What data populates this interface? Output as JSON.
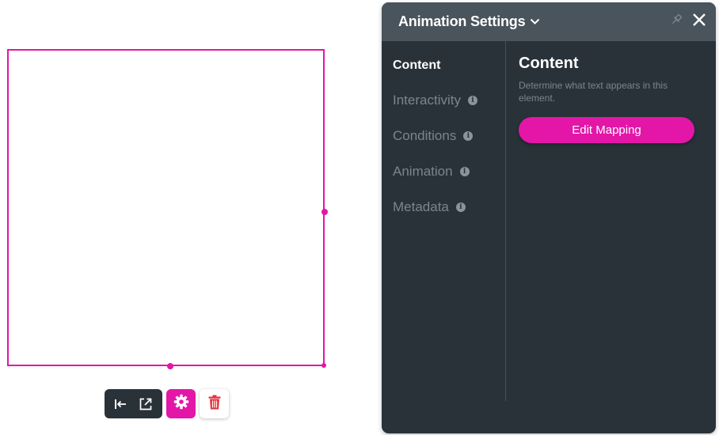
{
  "panel": {
    "title": "Animation Settings",
    "nav": [
      {
        "label": "Content",
        "active": true
      },
      {
        "label": "Interactivity",
        "info": "i"
      },
      {
        "label": "Conditions",
        "info": "i"
      },
      {
        "label": "Animation",
        "info": "i"
      },
      {
        "label": "Metadata",
        "info": "i"
      }
    ],
    "content": {
      "title": "Content",
      "description": "Determine what text appears in this element.",
      "button_label": "Edit Mapping"
    }
  },
  "toolbar": {
    "icons": [
      "align-left-icon",
      "external-link-icon",
      "gear-icon",
      "trash-icon"
    ]
  },
  "colors": {
    "accent": "#e316a8",
    "panel_bg": "#2a3239",
    "header_bg": "#49545d",
    "delete_red": "#e8313a"
  }
}
